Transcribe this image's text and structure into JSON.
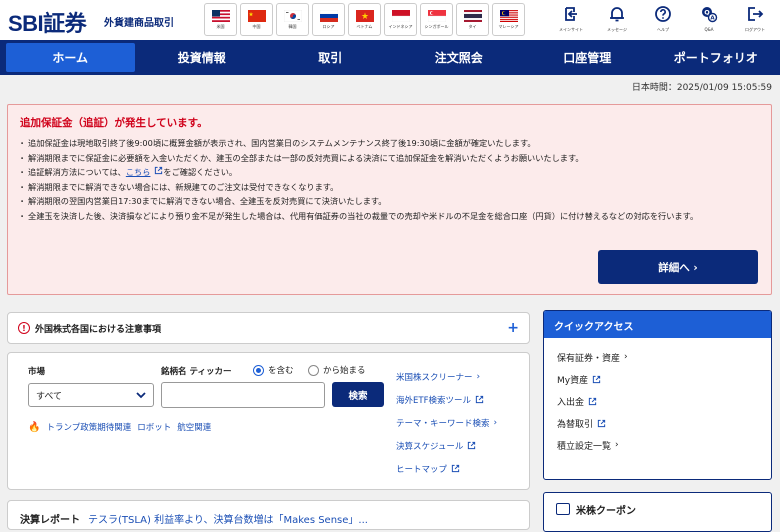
{
  "header": {
    "logo": "SBI証券",
    "subtitle": "外貨建商品取引",
    "flags": [
      {
        "label": "米国",
        "icon": "us-flag-icon"
      },
      {
        "label": "中国",
        "icon": "cn-flag-icon"
      },
      {
        "label": "韓国",
        "icon": "kr-flag-icon"
      },
      {
        "label": "ロシア",
        "icon": "ru-flag-icon"
      },
      {
        "label": "ベトナム",
        "icon": "vn-flag-icon"
      },
      {
        "label": "インドネシア",
        "icon": "id-flag-icon"
      },
      {
        "label": "シンガポール",
        "icon": "sg-flag-icon"
      },
      {
        "label": "タイ",
        "icon": "th-flag-icon"
      },
      {
        "label": "マレーシア",
        "icon": "my-flag-icon"
      }
    ],
    "tools": [
      {
        "label": "メインサイト",
        "icon": "main-site-icon"
      },
      {
        "label": "メッセージ",
        "icon": "message-icon"
      },
      {
        "label": "ヘルプ",
        "icon": "help-icon"
      },
      {
        "label": "Q&A",
        "icon": "qa-icon"
      },
      {
        "label": "ログアウト",
        "icon": "logout-icon"
      }
    ]
  },
  "nav": {
    "items": [
      "ホーム",
      "投資情報",
      "取引",
      "注文照会",
      "口座管理",
      "ポートフォリオ"
    ]
  },
  "timestamp": "日本時間：2025/01/09 15:05:59",
  "alert": {
    "title": "追加保証金（追証）が発生しています。",
    "lines": [
      "追加保証金は現地取引終了後9:00頃に概算金額が表示され、国内営業日のシステムメンテナンス終了後19:30頃に金額が確定いたします。",
      "解消期限までに保証金に必要額を入金いただくか、建玉の全部または一部の反対売買による決済にて追加保証金を解消いただくようお願いいたします。",
      "解消期限までに解消できない場合には、新規建てのご注文は受付できなくなります。",
      "解消期限の翌国内営業日17:30までに解消できない場合、全建玉を反対売買にて決済いたします。",
      "全建玉を決済した後、決済損などにより預り金不足が発生した場合は、代用有価証券の当社の裁量での売却や米ドルの不足金を総合口座（円貨）に付け替えるなどの対応を行います。"
    ],
    "link_line_prefix": "追証解消方法については、",
    "link_text": "こちら",
    "link_line_suffix": "をご確認ください。",
    "detail_button": "詳細へ ›"
  },
  "notice": {
    "icon": "!",
    "text": "外国株式各国における注意事項",
    "toggle": "+"
  },
  "search": {
    "market_label": "市場",
    "market_value": "すべて",
    "ticker_label": "銘柄名 ティッカー",
    "radio_contains": "を含む",
    "radio_starts": "から始まる",
    "ticker_placeholder": "",
    "button": "検索",
    "keywords": [
      "トランプ政策期待関連",
      "ロボット",
      "航空関連"
    ],
    "links": [
      {
        "label": "米国株スクリーナー",
        "type": "chevron"
      },
      {
        "label": "海外ETF検索ツール",
        "type": "external"
      },
      {
        "label": "テーマ・キーワード検索",
        "type": "chevron"
      },
      {
        "label": "決算スケジュール",
        "type": "external"
      },
      {
        "label": "ヒートマップ",
        "type": "external"
      }
    ]
  },
  "quick_access": {
    "title": "クイックアクセス",
    "items": [
      {
        "label": "保有証券・資産",
        "type": "chevron"
      },
      {
        "label": "My資産",
        "type": "external"
      },
      {
        "label": "入出金",
        "type": "external"
      },
      {
        "label": "為替取引",
        "type": "external"
      },
      {
        "label": "積立設定一覧",
        "type": "chevron"
      }
    ]
  },
  "report": {
    "title": "決算レポート",
    "link": "テスラ(TSLA) 利益率より、決算台数増は「Makes Sense」..."
  },
  "coupon": {
    "title": "米株クーポン"
  },
  "colors": {
    "brand_navy": "#0b2a7a",
    "accent_blue": "#1d5fd6",
    "alert_red": "#d0021b",
    "alert_bg": "#fcebeb"
  }
}
